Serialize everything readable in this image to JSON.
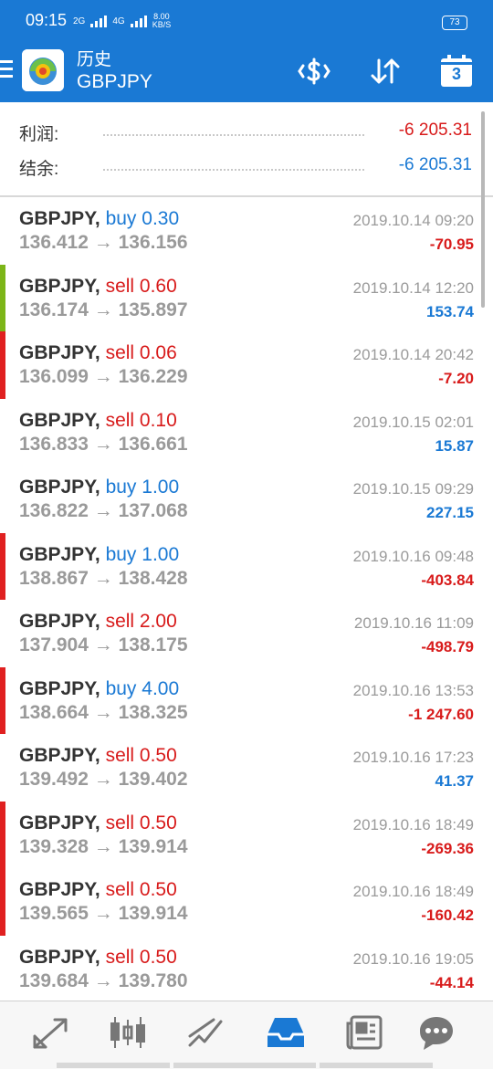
{
  "status_bar": {
    "time": "09:15",
    "network_a": "2G",
    "network_b": "4G",
    "speed_value": "8.00",
    "speed_unit": "KB/S",
    "battery": "73"
  },
  "header": {
    "title": "历史",
    "subtitle": "GBPJPY",
    "menu_icon": "hamburger-icon",
    "actions": [
      {
        "name": "currency-icon"
      },
      {
        "name": "sort-icon"
      },
      {
        "name": "calendar-icon",
        "label": "3"
      }
    ]
  },
  "summary": {
    "profit_label": "利润:",
    "profit_value": "-6 205.31",
    "balance_label": "结余:",
    "balance_value": "-6 205.31"
  },
  "colors": {
    "brand_blue": "#1a79d4",
    "buy": "#1a79d4",
    "sell": "#d81b1b",
    "loss": "#d81b1b",
    "profit": "#1a79d4",
    "bar_loss": "#e02020",
    "bar_profit": "#7cb518"
  },
  "trades": [
    {
      "symbol": "GBPJPY,",
      "side": "buy",
      "volume": "0.30",
      "open": "136.412",
      "close": "136.156",
      "time": "2019.10.14 09:20",
      "profit": "-70.95",
      "bar": "none"
    },
    {
      "symbol": "GBPJPY,",
      "side": "sell",
      "volume": "0.60",
      "open": "136.174",
      "close": "135.897",
      "time": "2019.10.14 12:20",
      "profit": "153.74",
      "bar": "green"
    },
    {
      "symbol": "GBPJPY,",
      "side": "sell",
      "volume": "0.06",
      "open": "136.099",
      "close": "136.229",
      "time": "2019.10.14 20:42",
      "profit": "-7.20",
      "bar": "red"
    },
    {
      "symbol": "GBPJPY,",
      "side": "sell",
      "volume": "0.10",
      "open": "136.833",
      "close": "136.661",
      "time": "2019.10.15 02:01",
      "profit": "15.87",
      "bar": "none"
    },
    {
      "symbol": "GBPJPY,",
      "side": "buy",
      "volume": "1.00",
      "open": "136.822",
      "close": "137.068",
      "time": "2019.10.15 09:29",
      "profit": "227.15",
      "bar": "none"
    },
    {
      "symbol": "GBPJPY,",
      "side": "buy",
      "volume": "1.00",
      "open": "138.867",
      "close": "138.428",
      "time": "2019.10.16 09:48",
      "profit": "-403.84",
      "bar": "red"
    },
    {
      "symbol": "GBPJPY,",
      "side": "sell",
      "volume": "2.00",
      "open": "137.904",
      "close": "138.175",
      "time": "2019.10.16 11:09",
      "profit": "-498.79",
      "bar": "none"
    },
    {
      "symbol": "GBPJPY,",
      "side": "buy",
      "volume": "4.00",
      "open": "138.664",
      "close": "138.325",
      "time": "2019.10.16 13:53",
      "profit": "-1 247.60",
      "bar": "red"
    },
    {
      "symbol": "GBPJPY,",
      "side": "sell",
      "volume": "0.50",
      "open": "139.492",
      "close": "139.402",
      "time": "2019.10.16 17:23",
      "profit": "41.37",
      "bar": "none"
    },
    {
      "symbol": "GBPJPY,",
      "side": "sell",
      "volume": "0.50",
      "open": "139.328",
      "close": "139.914",
      "time": "2019.10.16 18:49",
      "profit": "-269.36",
      "bar": "red"
    },
    {
      "symbol": "GBPJPY,",
      "side": "sell",
      "volume": "0.50",
      "open": "139.565",
      "close": "139.914",
      "time": "2019.10.16 18:49",
      "profit": "-160.42",
      "bar": "red"
    },
    {
      "symbol": "GBPJPY,",
      "side": "sell",
      "volume": "0.50",
      "open": "139.684",
      "close": "139.780",
      "time": "2019.10.16 19:05",
      "profit": "-44.14",
      "bar": "none"
    }
  ],
  "bottom_nav": [
    {
      "name": "quotes-icon",
      "active": false
    },
    {
      "name": "chart-icon",
      "active": false
    },
    {
      "name": "trade-icon",
      "active": false
    },
    {
      "name": "history-icon",
      "active": true
    },
    {
      "name": "news-icon",
      "active": false
    },
    {
      "name": "chat-icon",
      "active": false
    }
  ]
}
